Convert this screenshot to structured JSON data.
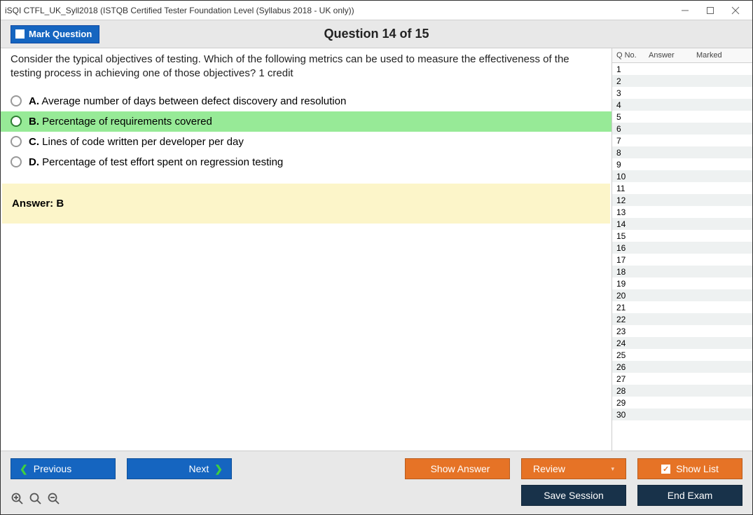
{
  "window": {
    "title": "iSQI CTFL_UK_Syll2018 (ISTQB Certified Tester Foundation Level (Syllabus 2018 - UK only))"
  },
  "topbar": {
    "mark_label": "Mark Question",
    "question_header": "Question 14 of 15"
  },
  "question": {
    "prompt": "Consider the typical objectives of testing. Which of the following metrics can be used to measure the effectiveness of the testing process in achieving one of those objectives? 1 credit",
    "options": [
      {
        "letter": "A.",
        "text": "Average number of days between defect discovery and resolution",
        "selected": false
      },
      {
        "letter": "B.",
        "text": "Percentage of requirements covered",
        "selected": true
      },
      {
        "letter": "C.",
        "text": "Lines of code written per developer per day",
        "selected": false
      },
      {
        "letter": "D.",
        "text": "Percentage of test effort spent on regression testing",
        "selected": false
      }
    ],
    "answer_label": "Answer: B"
  },
  "list": {
    "headers": {
      "qno": "Q No.",
      "answer": "Answer",
      "marked": "Marked"
    },
    "rows": [
      {
        "qno": "1"
      },
      {
        "qno": "2"
      },
      {
        "qno": "3"
      },
      {
        "qno": "4"
      },
      {
        "qno": "5"
      },
      {
        "qno": "6"
      },
      {
        "qno": "7"
      },
      {
        "qno": "8"
      },
      {
        "qno": "9"
      },
      {
        "qno": "10"
      },
      {
        "qno": "11"
      },
      {
        "qno": "12"
      },
      {
        "qno": "13"
      },
      {
        "qno": "14"
      },
      {
        "qno": "15"
      },
      {
        "qno": "16"
      },
      {
        "qno": "17"
      },
      {
        "qno": "18"
      },
      {
        "qno": "19"
      },
      {
        "qno": "20"
      },
      {
        "qno": "21"
      },
      {
        "qno": "22"
      },
      {
        "qno": "23"
      },
      {
        "qno": "24"
      },
      {
        "qno": "25"
      },
      {
        "qno": "26"
      },
      {
        "qno": "27"
      },
      {
        "qno": "28"
      },
      {
        "qno": "29"
      },
      {
        "qno": "30"
      }
    ]
  },
  "buttons": {
    "previous": "Previous",
    "next": "Next",
    "show_answer": "Show Answer",
    "review": "Review",
    "show_list": "Show List",
    "save_session": "Save Session",
    "end_exam": "End Exam"
  }
}
